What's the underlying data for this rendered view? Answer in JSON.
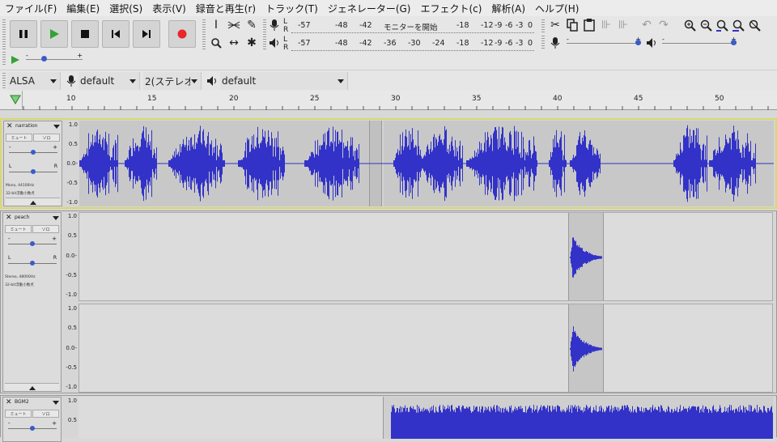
{
  "menu": {
    "items": [
      "ファイル(F)",
      "編集(E)",
      "選択(S)",
      "表示(V)",
      "録音と再生(r)",
      "トラック(T)",
      "ジェネレーター(G)",
      "エフェクト(c)",
      "解析(A)",
      "ヘルプ(H)"
    ]
  },
  "transport": {
    "pause_icon": "pause-icon",
    "play_icon": "play-icon",
    "stop_icon": "stop-icon",
    "skip_start_icon": "skip-to-start-icon",
    "skip_end_icon": "skip-to-end-icon",
    "record_icon": "record-icon",
    "record_color": "#e8262b",
    "play_color": "#2e9b2e"
  },
  "meters": {
    "record_scale": [
      "-57",
      "-48",
      "-42",
      "モニターを開始",
      "-18",
      "-12",
      "-9",
      "-6",
      "-3",
      "0"
    ],
    "play_scale": [
      "-57",
      "-48",
      "-42",
      "-36",
      "-30",
      "-24",
      "-18",
      "-12",
      "-9",
      "-6",
      "-3",
      "0"
    ],
    "lr": [
      "L",
      "R"
    ]
  },
  "device": {
    "host": "ALSA",
    "rec_device": "default",
    "channels": "2(ステレオ",
    "play_device": "default"
  },
  "ruler": {
    "ticks": [
      "10",
      "15",
      "20",
      "25",
      "30",
      "35",
      "40",
      "45",
      "50"
    ]
  },
  "tracks": [
    {
      "name": "narration",
      "mute": "ミュート",
      "solo": "ソロ",
      "pan_l": "L",
      "pan_r": "R",
      "gain_minus": "-",
      "gain_plus": "+",
      "info1": "Mono, 44100Hz",
      "info2": "32-bit浮動小数点",
      "scale": [
        "1.0",
        "0.5",
        "0.0-",
        "-0.5",
        "-1.0"
      ]
    },
    {
      "name": "peach",
      "mute": "ミュート",
      "solo": "ソロ",
      "pan_l": "L",
      "pan_r": "R",
      "gain_minus": "-",
      "gain_plus": "+",
      "info1": "Stereo, 48000Hz",
      "info2": "32-bit浮動小数点",
      "scale": [
        "1.0",
        "0.5",
        "0.0-",
        "-0.5",
        "-1.0"
      ],
      "scale2": [
        "1.0",
        "0.5",
        "0.0-",
        "-0.5",
        "-1.0"
      ]
    },
    {
      "name": "BGM2",
      "mute": "ミュート",
      "solo": "ソロ",
      "gain_minus": "-",
      "gain_plus": "+",
      "scale": [
        "1.0",
        "0.5"
      ]
    }
  ],
  "colors": {
    "waveform": "#3232c8",
    "selection_border": "#d8d870"
  }
}
